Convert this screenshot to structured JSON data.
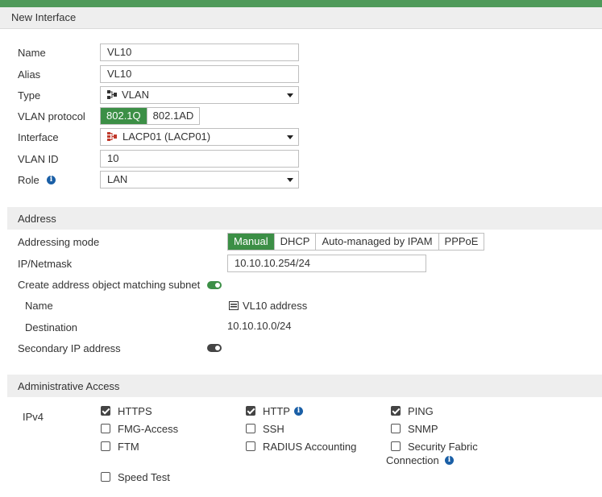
{
  "title": "New Interface",
  "form": {
    "name_label": "Name",
    "name_value": "VL10",
    "alias_label": "Alias",
    "alias_value": "VL10",
    "type_label": "Type",
    "type_value": "VLAN",
    "vlan_protocol_label": "VLAN protocol",
    "vlan_protocol_options": [
      "802.1Q",
      "802.1AD"
    ],
    "vlan_protocol_selected": "802.1Q",
    "interface_label": "Interface",
    "interface_value": "LACP01 (LACP01)",
    "vlan_id_label": "VLAN ID",
    "vlan_id_value": "10",
    "role_label": "Role",
    "role_value": "LAN"
  },
  "address": {
    "section_title": "Address",
    "mode_label": "Addressing mode",
    "mode_options": [
      "Manual",
      "DHCP",
      "Auto-managed by IPAM",
      "PPPoE"
    ],
    "mode_selected": "Manual",
    "ipmask_label": "IP/Netmask",
    "ipmask_value": "10.10.10.254/24",
    "create_object_label": "Create address object matching subnet",
    "create_object_enabled": true,
    "obj_name_label": "Name",
    "obj_name_value": "VL10 address",
    "destination_label": "Destination",
    "destination_value": "10.10.10.0/24",
    "secondary_label": "Secondary IP address",
    "secondary_enabled": false
  },
  "admin": {
    "section_title": "Administrative Access",
    "ipv4_label": "IPv4",
    "https": "HTTPS",
    "http": "HTTP",
    "ping": "PING",
    "fmg": "FMG-Access",
    "ssh": "SSH",
    "snmp": "SNMP",
    "ftm": "FTM",
    "radius": "RADIUS Accounting",
    "secfab": "Security Fabric",
    "secfab2": "Connection",
    "speedtest": "Speed Test",
    "checked": {
      "https": true,
      "http": true,
      "ping": true,
      "fmg": false,
      "ssh": false,
      "snmp": false,
      "ftm": false,
      "radius": false,
      "secfab": false,
      "speedtest": false
    }
  },
  "colors": {
    "accent_green": "#3c8f46",
    "info_blue": "#1a5fa6"
  }
}
